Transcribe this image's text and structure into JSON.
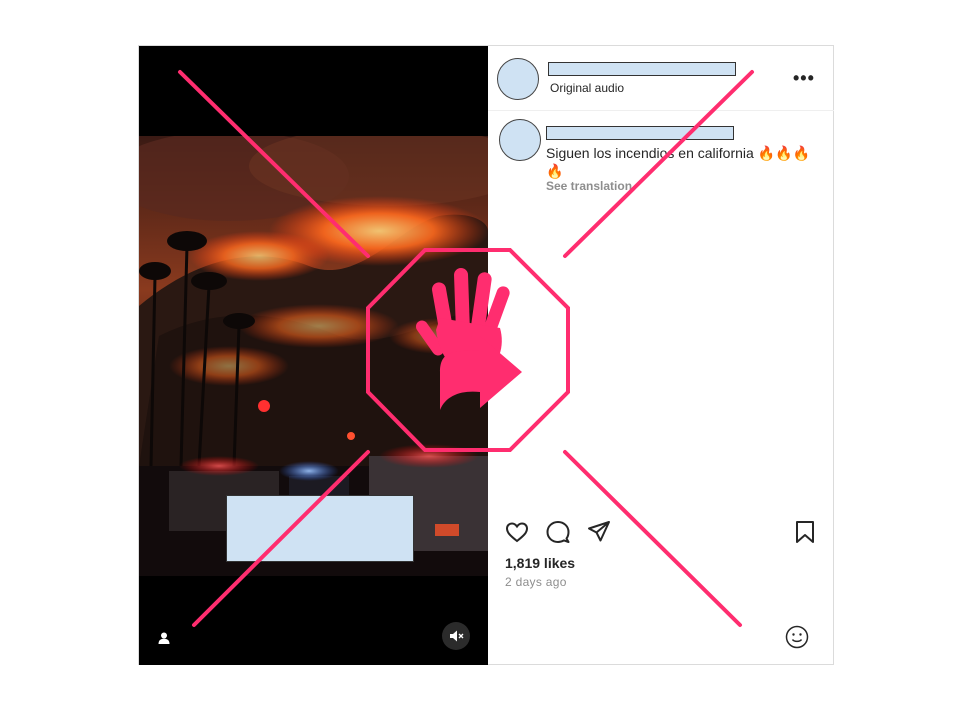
{
  "header": {
    "audio_label": "Original audio",
    "more_label": "•••"
  },
  "caption": {
    "text": "Siguen los incendios en california 🔥🔥🔥🔥",
    "see_translation": "See translation"
  },
  "engagement": {
    "likes": "1,819 likes",
    "time": "2 days ago"
  },
  "colors": {
    "overlay": "#ff2d6f",
    "redaction": "#cfe2f3"
  },
  "icons": {
    "like": "heart-icon",
    "comment": "comment-icon",
    "share": "send-icon",
    "save": "bookmark-icon",
    "emoji": "emoji-icon",
    "mute": "speaker-muted-icon",
    "tag": "user-tag-icon",
    "stop": "stop-hand-icon"
  }
}
